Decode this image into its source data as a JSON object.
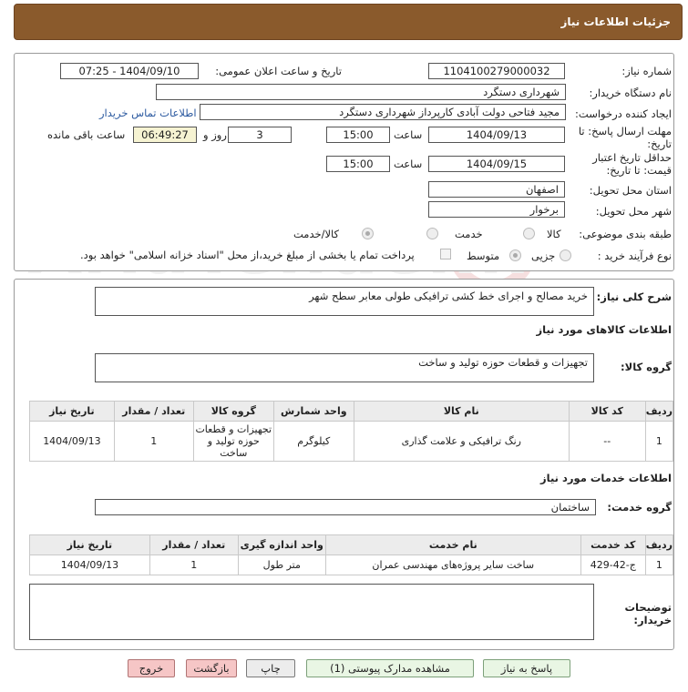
{
  "header": {
    "title": "جزئیات اطلاعات نیاز"
  },
  "need_info": {
    "need_number_label": "شماره نیاز:",
    "need_number": "1104100279000032",
    "announce_label": "تاریخ و ساعت اعلان عمومی:",
    "announce_value": "1404/09/10 - 07:25",
    "buyer_label": "نام دستگاه خریدار:",
    "buyer_value": "شهرداری دستگرد",
    "creator_label": "ایجاد کننده درخواست:",
    "creator_value": "مجید فتاحی دولت آبادی کارپرداز شهرداری دستگرد",
    "contact_link": "اطلاعات تماس خریدار",
    "deadline_label_1": "مهلت ارسال پاسخ: تا",
    "deadline_label_2": "تاریخ:",
    "deadline_date": "1404/09/13",
    "time_label": "ساعت",
    "deadline_time": "15:00",
    "days_value": "3",
    "days_label": "روز و",
    "remaining_time": "06:49:27",
    "remaining_label": "ساعت باقی مانده",
    "validity_label_1": "حداقل تاریخ اعتبار",
    "validity_label_2": "قیمت: تا تاریخ:",
    "validity_date": "1404/09/15",
    "validity_time": "15:00",
    "province_label": "استان محل تحویل:",
    "province_value": "اصفهان",
    "city_label": "شهر محل تحویل:",
    "city_value": "برخوار",
    "category_label": "طبقه بندی موضوعی:",
    "category_options": [
      "کالا",
      "خدمت",
      "کالا/خدمت"
    ],
    "process_label": "نوع فرآیند خرید :",
    "process_options": [
      "جزیی",
      "متوسط"
    ],
    "payment_note": "پرداخت تمام یا بخشی از مبلغ خرید،از محل \"اسناد خزانه اسلامی\" خواهد بود."
  },
  "description": {
    "label": "شرح کلی نیاز:",
    "value": "خرید مصالح و اجرای خط کشی ترافیکی طولی معابر سطح شهر"
  },
  "goods": {
    "section_title": "اطلاعات کالاهای مورد نیاز",
    "group_label": "گروه کالا:",
    "group_value": "تجهیزات و قطعات حوزه تولید و ساخت",
    "columns": [
      "ردیف",
      "کد کالا",
      "نام کالا",
      "واحد شمارش",
      "گروه کالا",
      "تعداد / مقدار",
      "تاریخ نیاز"
    ],
    "rows": [
      [
        "1",
        "--",
        "رنگ ترافیکی و علامت گذاری",
        "کیلوگرم",
        "تجهیزات و قطعات حوزه تولید و ساخت",
        "1",
        "1404/09/13"
      ]
    ]
  },
  "services": {
    "section_title": "اطلاعات خدمات مورد نیاز",
    "group_label": "گروه خدمت:",
    "group_value": "ساختمان",
    "columns": [
      "ردیف",
      "کد خدمت",
      "نام خدمت",
      "واحد اندازه گیری",
      "تعداد / مقدار",
      "تاریخ نیاز"
    ],
    "rows": [
      [
        "1",
        "ج-42-429",
        "ساخت سایر پروژه‌های مهندسی عمران",
        "متر طول",
        "1",
        "1404/09/13"
      ]
    ]
  },
  "buyer_notes": {
    "label_1": "توضیحات",
    "label_2": "خریدار:",
    "value": ""
  },
  "buttons": {
    "reply": "پاسخ به نیاز",
    "attachments": "مشاهده مدارک پیوستی (1)",
    "print": "چاپ",
    "back": "بازگشت",
    "exit": "خروج"
  },
  "colors": {
    "header_bg": "#8a5a2c",
    "link": "#2c5aa0",
    "time_highlight": "#f6f3d2"
  }
}
